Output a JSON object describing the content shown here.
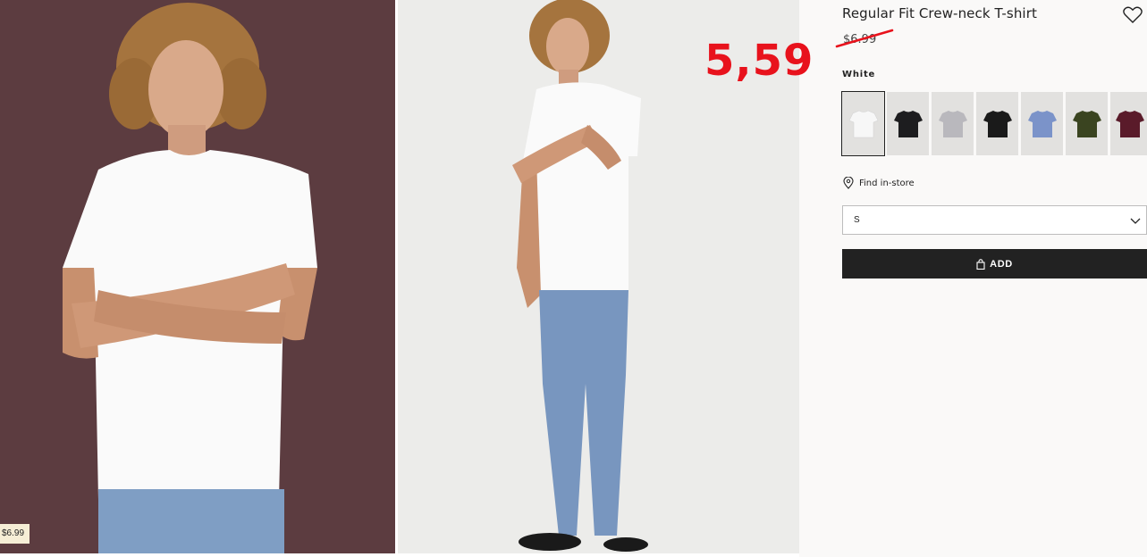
{
  "product": {
    "title": "Regular Fit Crew-neck T-shirt",
    "old_price": "$6.99",
    "handwritten_price": "5,59",
    "image_price_tag": "$6.99"
  },
  "color": {
    "selected_label": "White",
    "swatches": [
      {
        "name": "White",
        "color": "#f4f4f4"
      },
      {
        "name": "Black",
        "color": "#1d1d1f"
      },
      {
        "name": "Light grey",
        "color": "#b9b8bd"
      },
      {
        "name": "Black",
        "color": "#1a1a1a"
      },
      {
        "name": "Blue",
        "color": "#7b93c9"
      },
      {
        "name": "Dark green",
        "color": "#3a4420"
      },
      {
        "name": "Burgundy",
        "color": "#5a1b2a"
      }
    ]
  },
  "store": {
    "find_label": "Find in-store"
  },
  "size": {
    "selected": "S"
  },
  "cart": {
    "add_label": "ADD"
  },
  "icons": {
    "wishlist": "heart-icon",
    "store": "location-pin-icon",
    "size_toggle": "chevron-down-icon",
    "cart": "shopping-bag-icon"
  },
  "colors": {
    "accent_red": "#e8121c",
    "button_bg": "#222222",
    "left_backdrop": "#5c3c40",
    "right_backdrop": "#ececea"
  }
}
